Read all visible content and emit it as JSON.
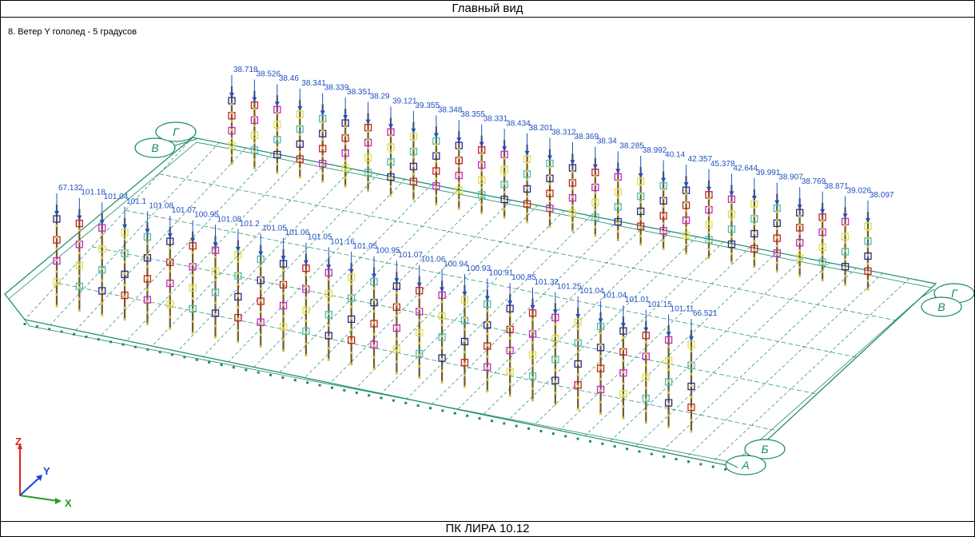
{
  "window": {
    "title": "Главный вид",
    "footer": "ПК ЛИРА 10.12"
  },
  "viewport": {
    "load_case": "8. Ветер Y гололед - 5 градусов",
    "back_row_top_values": [
      "38.718",
      "38.526",
      "38.46",
      "38.341",
      "38.339",
      "38.351",
      "38.29",
      "39.121",
      "39.355",
      "38.348",
      "38.355",
      "38.331",
      "38.434",
      "38.201",
      "38.312",
      "38.369",
      "38.34",
      "38.285",
      "38.992",
      "40.14",
      "42.357",
      "45.378",
      "42.644",
      "39.991",
      "38.907",
      "38.769",
      "38.871",
      "39.026",
      "38.097"
    ],
    "front_row_top_values": [
      "67.132",
      "101.18",
      "101.04",
      "101.1",
      "101.08",
      "101.07",
      "100.95",
      "101.08",
      "101.2",
      "101.05",
      "101.06",
      "101.05",
      "101.16",
      "101.05",
      "100.95",
      "101.07",
      "101.06",
      "100.94",
      "100.93",
      "100.91",
      "100.85",
      "101.32",
      "101.25",
      "101.04",
      "101.04",
      "101.01",
      "101.15",
      "101.11",
      "66.521"
    ],
    "axis_bubbles": {
      "back_left_outer": "В",
      "back_left_inner": "Г",
      "right_upper": "Г",
      "right_lower": "В",
      "front_right_upper": "Б",
      "front_right_lower": "А"
    },
    "triad": {
      "z_label": "Z",
      "y_label": "Y",
      "x_label": "X",
      "z_color": "#e02020",
      "y_color": "#2040e0",
      "x_color": "#20a020"
    },
    "colors": {
      "grid": "#1a8a6a",
      "label": "#1f4fc0",
      "post": "#6b5a30",
      "node_dark": "#2a2a90",
      "node_red": "#cc2020",
      "node_magenta": "#cc22cc",
      "node_yellow": "#e0e040",
      "node_cyan": "#40c0c0"
    }
  }
}
